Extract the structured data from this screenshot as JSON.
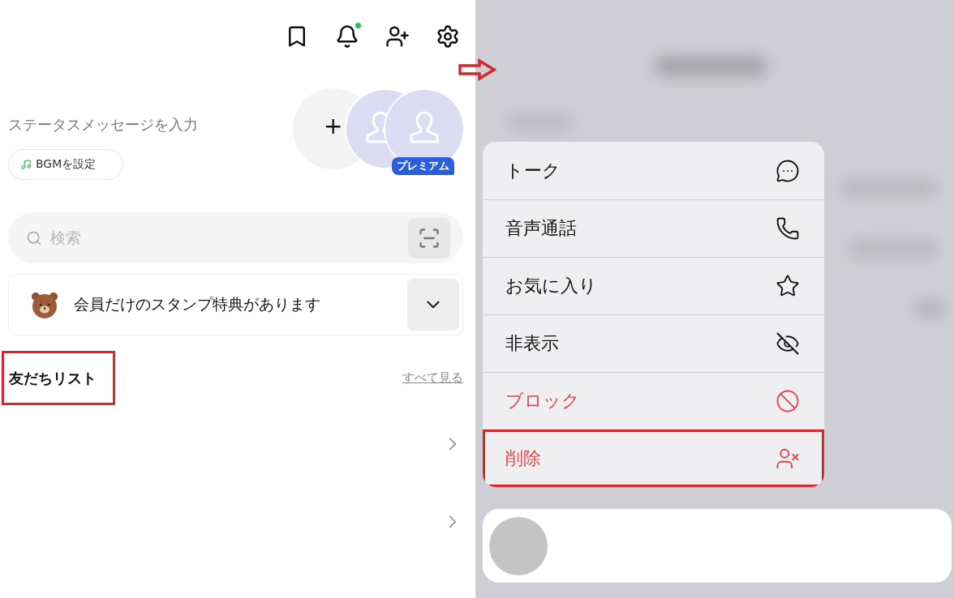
{
  "header": {
    "notification_dot": true
  },
  "profile": {
    "status_placeholder": "ステータスメッセージを入力",
    "bgm_button": "BGMを設定",
    "add_symbol": "+",
    "premium_badge": "プレミアム"
  },
  "search": {
    "placeholder": "検索"
  },
  "banner": {
    "text": "会員だけのスタンプ特典があります"
  },
  "friends": {
    "heading": "友だちリスト",
    "heading_highlighted": true,
    "see_all": "すべて見る"
  },
  "context_menu": [
    {
      "label": "トーク",
      "kind": "default",
      "highlighted": false
    },
    {
      "label": "音声通話",
      "kind": "default",
      "highlighted": false
    },
    {
      "label": "お気に入り",
      "kind": "default",
      "highlighted": false
    },
    {
      "label": "非表示",
      "kind": "default",
      "highlighted": false
    },
    {
      "label": "ブロック",
      "kind": "danger",
      "highlighted": false
    },
    {
      "label": "削除",
      "kind": "danger",
      "highlighted": true
    }
  ]
}
